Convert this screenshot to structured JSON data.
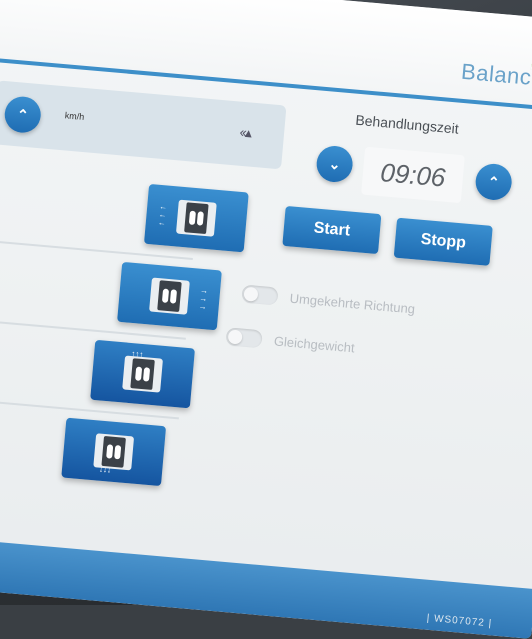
{
  "brand": {
    "name": "BalanceTu"
  },
  "speed": {
    "unit": "km/h",
    "direction_icon": "arrows-icon"
  },
  "session": {
    "label": "Behandlungszeit",
    "time": "09:06"
  },
  "actions": {
    "start": "Start",
    "stop": "Stopp"
  },
  "toggles": [
    {
      "label": "Umgekehrte Richtung",
      "state": "off"
    },
    {
      "label": "Gleichgewicht",
      "state": "off"
    }
  ],
  "modes": [
    {
      "name": "lateral-left",
      "icon": "feet-lateral-icon"
    },
    {
      "name": "lateral-right",
      "icon": "feet-lateral-icon"
    },
    {
      "name": "forward",
      "icon": "feet-forward-icon"
    },
    {
      "name": "backward",
      "icon": "feet-backward-icon"
    }
  ],
  "footer": {
    "text": "| WS07072 |"
  },
  "colors": {
    "accent": "#1f6db3",
    "header_line": "#3d8fc9",
    "brand": "#6aa2c9"
  }
}
